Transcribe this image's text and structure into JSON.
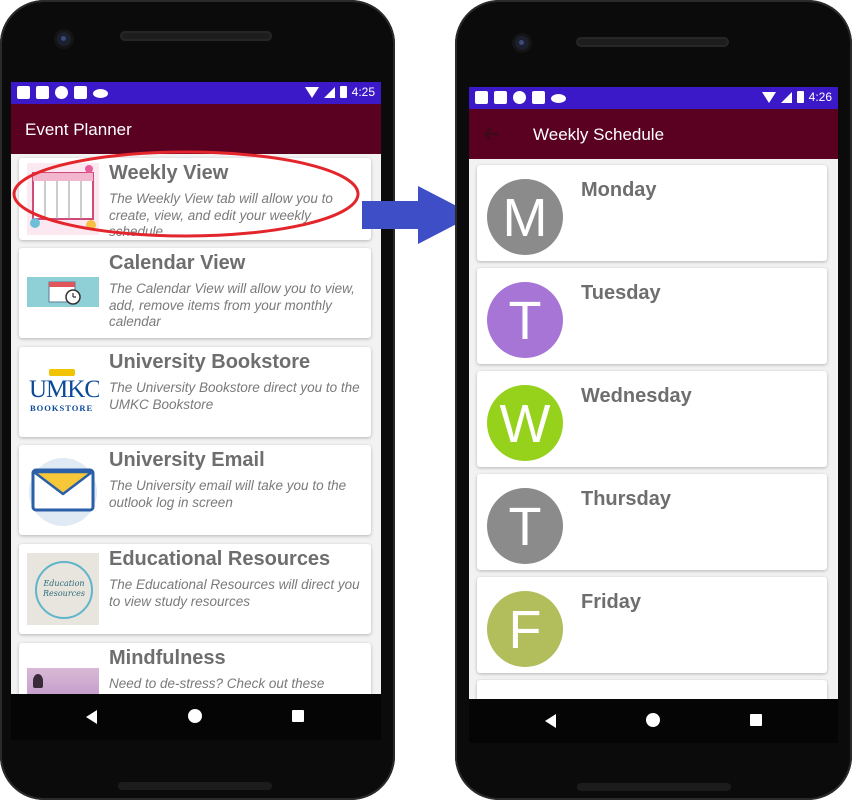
{
  "left_phone": {
    "status_time": "4:25",
    "app_title": "Event Planner",
    "cards": [
      {
        "title": "Weekly View",
        "desc": "The Weekly View tab will allow you to create, view, and edit your weekly schedule"
      },
      {
        "title": "Calendar View",
        "desc": "The Calendar View will allow you to view, add, remove items from your monthly calendar"
      },
      {
        "title": "University Bookstore",
        "desc": "The University Bookstore direct you to the UMKC Bookstore"
      },
      {
        "title": "University Email",
        "desc": "The University email will take you to the outlook log in screen"
      },
      {
        "title": "Educational Resources",
        "desc": "The Educational Resources will direct you to view study resources"
      },
      {
        "title": "Mindfulness",
        "desc": "Need to de-stress? Check out these"
      }
    ],
    "thumbs": {
      "umkc_logo": "UMKC",
      "umkc_sub": "BOOKSTORE",
      "edu_text": "Education Resources"
    }
  },
  "right_phone": {
    "status_time": "4:26",
    "screen_title": "Weekly Schedule",
    "days": [
      {
        "letter": "M",
        "name": "Monday",
        "color": "#8b8b8b"
      },
      {
        "letter": "T",
        "name": "Tuesday",
        "color": "#a775d6"
      },
      {
        "letter": "W",
        "name": "Wednesday",
        "color": "#96d11b"
      },
      {
        "letter": "T",
        "name": "Thursday",
        "color": "#8b8b8b"
      },
      {
        "letter": "F",
        "name": "Friday",
        "color": "#b2bd5c"
      }
    ]
  },
  "colors": {
    "status_bar": "#3b18c8",
    "app_bar": "#5a0020",
    "arrow": "#3d4ec6",
    "highlight": "#e3262c"
  },
  "icons": [
    "back-arrow-icon",
    "wifi-icon",
    "signal-icon",
    "battery-icon",
    "nav-back-icon",
    "nav-home-icon",
    "nav-recents-icon",
    "mail-envelope-icon"
  ]
}
